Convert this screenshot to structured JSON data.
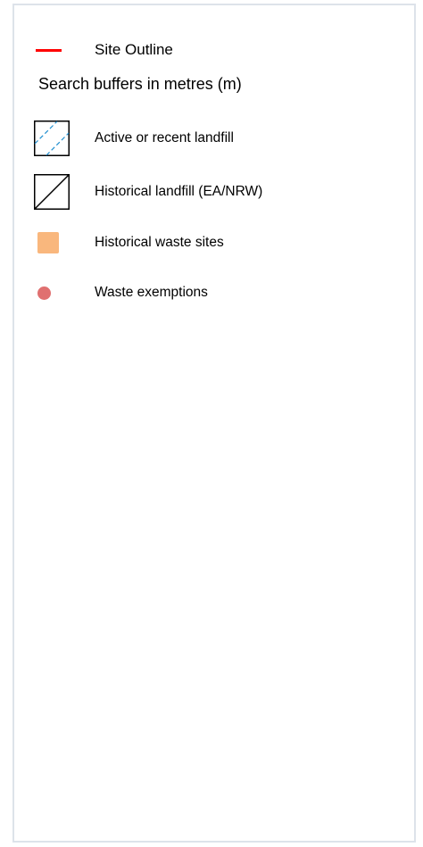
{
  "legend": {
    "site_outline": {
      "label": "Site Outline",
      "color": "#ff0000"
    },
    "buffers_title": "Search buffers in metres (m)",
    "items": [
      {
        "label": "Active or recent landfill",
        "icon": "dashed-hatch-square-icon",
        "hatch_color": "#1f8fd0"
      },
      {
        "label": "Historical landfill (EA/NRW)",
        "icon": "diagonal-line-square-icon",
        "line_color": "#000000"
      },
      {
        "label": "Historical waste sites",
        "icon": "orange-square-icon",
        "fill_color": "#f9b77d"
      },
      {
        "label": "Waste exemptions",
        "icon": "red-dot-icon",
        "fill_color": "#e07070"
      }
    ]
  }
}
